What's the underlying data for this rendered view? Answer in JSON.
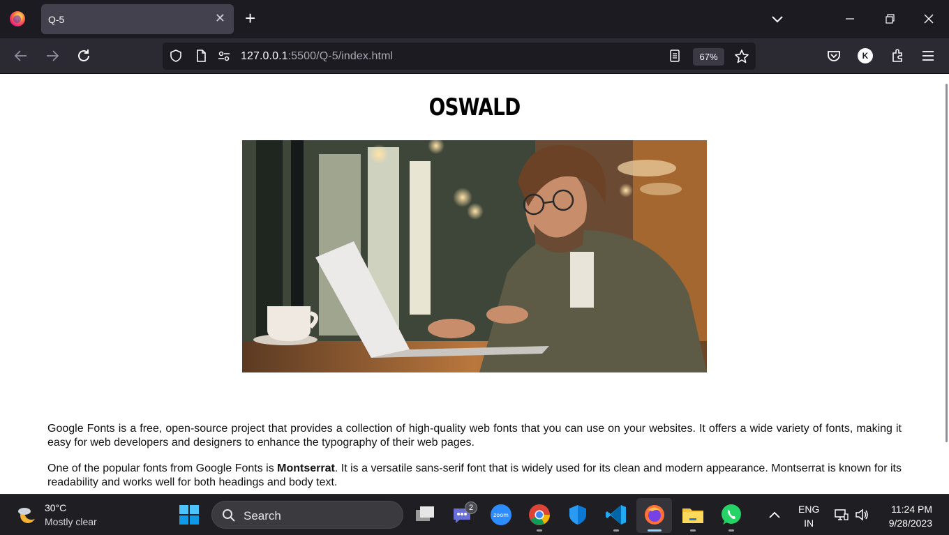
{
  "browser": {
    "tab_title": "Q-5",
    "url_host": "127.0.0.1",
    "url_path": ":5500/Q-5/index.html",
    "zoom": "67%",
    "account_initial": "K"
  },
  "page": {
    "heading": "OSWALD",
    "image_alt": "Young man with glasses working on a laptop in a cafe",
    "paragraph1": "Google Fonts is a free, open-source project that provides a collection of high-quality web fonts that you can use on your websites. It offers a wide variety of fonts, making it easy for web developers and designers to enhance the typography of their web pages.",
    "paragraph2_before": "One of the popular fonts from Google Fonts is ",
    "paragraph2_bold": "Montserrat",
    "paragraph2_after": ". It is a versatile sans-serif font that is widely used for its clean and modern appearance. Montserrat is known for its readability and works well for both headings and body text."
  },
  "taskbar": {
    "temperature": "30°C",
    "condition": "Mostly clear",
    "search_label": "Search",
    "teams_badge": "2",
    "lang_line1": "ENG",
    "lang_line2": "IN",
    "time": "11:24 PM",
    "date": "9/28/2023"
  },
  "colors": {
    "chrome_dark": "#1c1b22",
    "toolbar": "#2b2a33",
    "tab_active": "#42414d",
    "taskbar": "#1f1f23"
  }
}
